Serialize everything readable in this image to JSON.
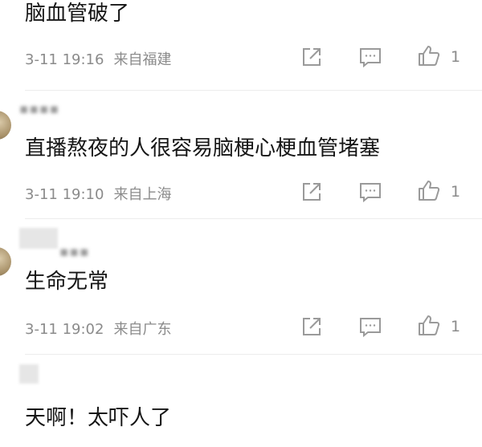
{
  "comments": [
    {
      "text": "脑血管破了",
      "date": "3-11 19:16",
      "location": "来自福建",
      "likes": "1"
    },
    {
      "text": "直播熬夜的人很容易脑梗心梗血管堵塞",
      "date": "3-11 19:10",
      "location": "来自上海",
      "likes": "1"
    },
    {
      "text": "生命无常",
      "date": "3-11 19:02",
      "location": "来自广东",
      "likes": "1"
    },
    {
      "text": "天啊！太吓人了"
    }
  ],
  "icons": {
    "share": "share-icon",
    "reply": "comment-icon",
    "like": "thumbs-up-icon"
  },
  "colors": {
    "text": "#161616",
    "meta": "#8b8b8b",
    "icon": "#9a9a9a"
  }
}
